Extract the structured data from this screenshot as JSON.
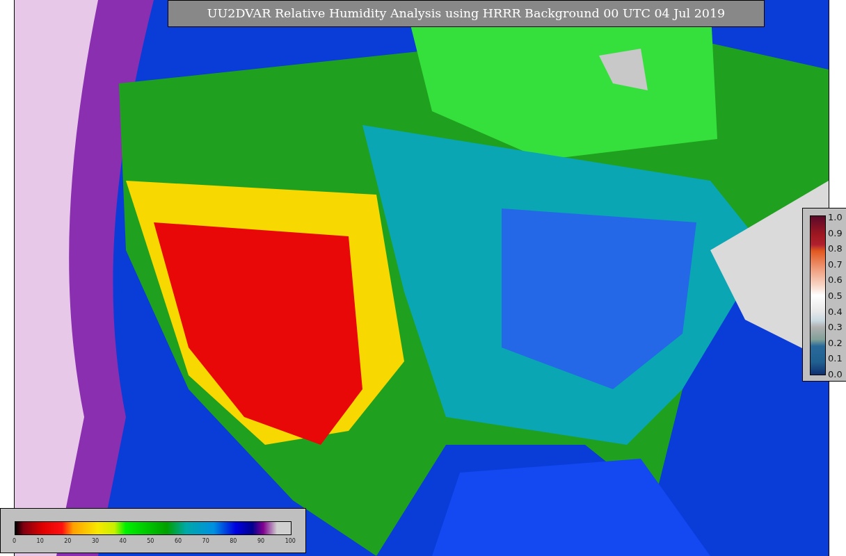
{
  "title": "UU2DVAR Relative Humidity Analysis using HRRR Background 00 UTC 04 Jul 2019",
  "side_colorbar": {
    "ticks": [
      "1.0",
      "0.9",
      "0.8",
      "0.7",
      "0.6",
      "0.5",
      "0.4",
      "0.3",
      "0.2",
      "0.1",
      "0.0"
    ]
  },
  "bottom_colorbar": {
    "ticks": [
      "0",
      "10",
      "20",
      "30",
      "40",
      "50",
      "60",
      "70",
      "80",
      "90",
      "100"
    ]
  }
}
